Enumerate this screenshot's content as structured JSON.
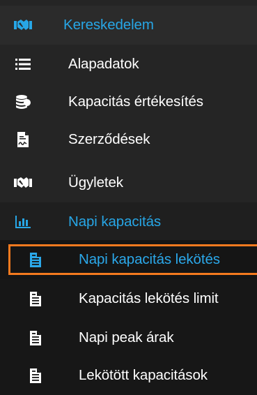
{
  "menu": {
    "section": {
      "label": "Kereskedelem",
      "icon": "handshake-icon"
    },
    "items": [
      {
        "label": "Alapadatok",
        "icon": "list-icon"
      },
      {
        "label": "Kapacitás értékesítés",
        "icon": "coins-icon"
      },
      {
        "label": "Szerződések",
        "icon": "contract-icon"
      },
      {
        "label": "Ügyletek",
        "icon": "handshake-icon"
      }
    ],
    "subsection": {
      "label": "Napi kapacitás",
      "icon": "bar-chart-icon"
    },
    "subitems": [
      {
        "label": "Napi kapacitás lekötés",
        "icon": "document-icon",
        "active": true
      },
      {
        "label": "Kapacitás lekötés limit",
        "icon": "document-icon"
      },
      {
        "label": "Napi peak árak",
        "icon": "document-icon"
      },
      {
        "label": "Lekötött kapacitások",
        "icon": "document-icon"
      }
    ]
  },
  "colors": {
    "accent": "#27a6e6",
    "highlight_border": "#f47a1f",
    "background": "#252525"
  }
}
